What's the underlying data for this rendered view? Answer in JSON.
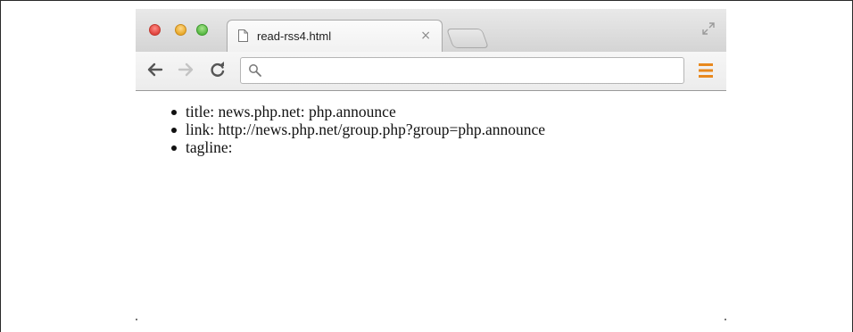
{
  "browser": {
    "tab": {
      "title": "read-rss4.html",
      "close_glyph": "×"
    },
    "omnibox": {
      "value": "",
      "placeholder": ""
    },
    "icons": {
      "back": "back-arrow-icon",
      "forward": "forward-arrow-icon",
      "reload": "reload-icon",
      "search": "search-icon",
      "menu": "menu-icon",
      "fullscreen": "fullscreen-icon",
      "page": "page-icon"
    },
    "colors": {
      "menu_accent": "#e8891f",
      "close": "#e0443e",
      "minimize": "#e8a92a",
      "zoom": "#58b843"
    }
  },
  "page": {
    "items": [
      "title: news.php.net: php.announce",
      "link: http://news.php.net/group.php?group=php.announce",
      "tagline:"
    ]
  }
}
